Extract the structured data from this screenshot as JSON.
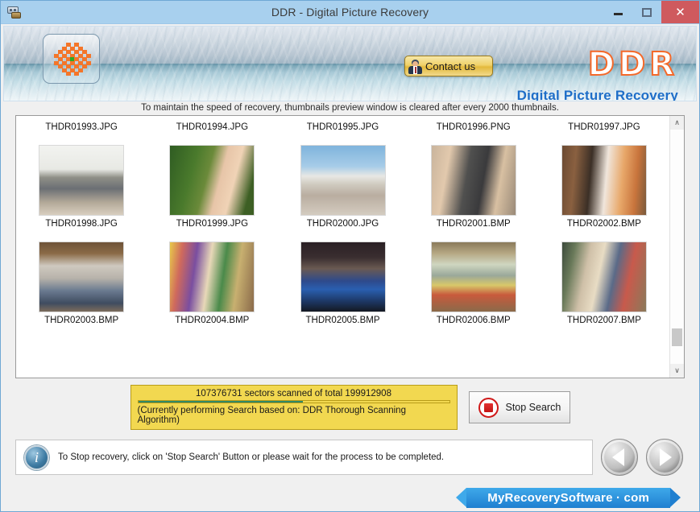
{
  "window": {
    "title": "DDR - Digital Picture Recovery",
    "app_icon": "camera-icon",
    "minimize_label": "–",
    "maximize_label": "□",
    "close_label": "✕"
  },
  "header": {
    "logo_icon": "checkerboard-logo-icon",
    "contact_button": "Contact us",
    "contact_icon": "person-icon",
    "brand": "DDR",
    "brand_subtitle": "Digital Picture Recovery",
    "brand_color": "#f4692a",
    "subtitle_color": "#1e6ec8"
  },
  "notice": "To maintain the speed of recovery, thumbnails preview window is cleared after every 2000 thumbnails.",
  "thumbnails": {
    "rows": [
      {
        "labels_only": true,
        "items": [
          {
            "name": "THDR01993.JPG"
          },
          {
            "name": "THDR01994.JPG"
          },
          {
            "name": "THDR01995.JPG"
          },
          {
            "name": "THDR01996.PNG"
          },
          {
            "name": "THDR01997.JPG"
          }
        ]
      },
      {
        "labels_only": false,
        "items": [
          {
            "name": "THDR01998.JPG"
          },
          {
            "name": "THDR01999.JPG"
          },
          {
            "name": "THDR02000.JPG"
          },
          {
            "name": "THDR02001.BMP"
          },
          {
            "name": "THDR02002.BMP"
          }
        ]
      },
      {
        "labels_only": false,
        "items": [
          {
            "name": "THDR02003.BMP"
          },
          {
            "name": "THDR02004.BMP"
          },
          {
            "name": "THDR02005.BMP"
          },
          {
            "name": "THDR02006.BMP"
          },
          {
            "name": "THDR02007.BMP"
          }
        ]
      }
    ],
    "scrollbar": {
      "up_arrow": "∧",
      "down_arrow": "∨"
    }
  },
  "progress": {
    "status_text": "107376731 sectors scanned of total 199912908",
    "sectors_scanned": 107376731,
    "sectors_total": 199912908,
    "percent": 53,
    "algorithm_text": "(Currently performing Search based on:  DDR Thorough Scanning Algorithm)",
    "bar_color": "#2f8461",
    "panel_color": "#f2d850"
  },
  "stop_button": {
    "label": "Stop Search",
    "icon": "stop-square-icon"
  },
  "footer": {
    "info_icon": "info-icon",
    "info_glyph": "i",
    "info_text": "To Stop recovery, click on 'Stop Search' Button or please wait for the process to be completed.",
    "prev_icon": "previous-arrow-icon",
    "next_icon": "next-arrow-icon"
  },
  "brandbar": {
    "text": "MyRecoverySoftware · com",
    "color": "#1f7fd0"
  }
}
